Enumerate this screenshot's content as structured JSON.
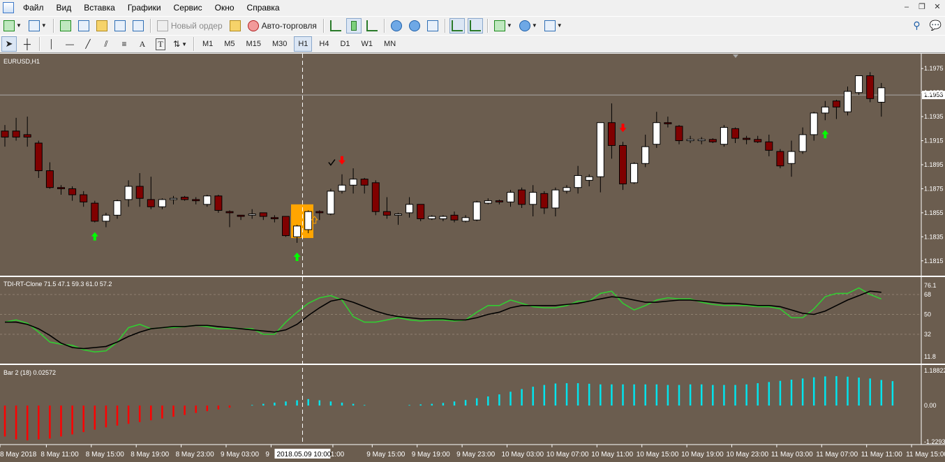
{
  "menu": [
    "Файл",
    "Вид",
    "Вставка",
    "Графики",
    "Сервис",
    "Окно",
    "Справка"
  ],
  "toolbar": {
    "new_order": "Новый ордер",
    "auto_trading": "Авто-торговля"
  },
  "timeframes": [
    "M1",
    "M5",
    "M15",
    "M30",
    "H1",
    "H4",
    "D1",
    "W1",
    "MN"
  ],
  "active_timeframe": "H1",
  "charts": {
    "main": {
      "label": "EURUSD,H1",
      "price_labels": [
        "1.1975",
        "1.1955",
        "1.1935",
        "1.1915",
        "1.1895",
        "1.1875",
        "1.1855",
        "1.1835",
        "1.1815"
      ],
      "current_price": "1.1953"
    },
    "tdi": {
      "label": "TDI-RT-Clone 71.5 47.1 59.3 61.0 57.2",
      "levels": [
        "76.1",
        "68",
        "50",
        "32",
        "11.8"
      ]
    },
    "bar2": {
      "label": "Bar 2  (18) 0.02572",
      "levels": [
        "1.18822",
        "0.00",
        "-1.22932"
      ]
    }
  },
  "time_axis": {
    "labels": [
      "8 May 2018",
      "8 May 11:00",
      "8 May 15:00",
      "8 May 19:00",
      "8 May 23:00",
      "9 May 03:00",
      "9",
      "11:00",
      "9 May 15:00",
      "9 May 19:00",
      "9 May 23:00",
      "10 May 03:00",
      "10 May 07:00",
      "10 May 11:00",
      "10 May 15:00",
      "10 May 19:00",
      "10 May 23:00",
      "11 May 03:00",
      "11 May 07:00",
      "11 May 11:00",
      "11 May 15:00"
    ],
    "crosshair_label": "2018.05.09 10:00"
  },
  "colors": {
    "chart_bg": "#6b5d4f",
    "bull_candle": "#ffffff",
    "bear_candle": "#800000",
    "tdi_green": "#32cd32",
    "tdi_black": "#000000",
    "bar_negative": "#ff0000",
    "bar_positive": "#00e5ee",
    "signal_up": "#00ff00",
    "signal_down": "#ff0000",
    "highlight": "#ffa500"
  },
  "chart_data": [
    {
      "type": "candlestick",
      "title": "EURUSD,H1",
      "ylim": [
        1.1805,
        1.1985
      ],
      "candles": [
        [
          1.1923,
          1.1928,
          1.191,
          1.1918
        ],
        [
          1.1923,
          1.1934,
          1.1915,
          1.1918
        ],
        [
          1.192,
          1.1935,
          1.191,
          1.1918
        ],
        [
          1.1913,
          1.1915,
          1.1884,
          1.189
        ],
        [
          1.189,
          1.1897,
          1.1875,
          1.1876
        ],
        [
          1.1876,
          1.1878,
          1.187,
          1.1875
        ],
        [
          1.1875,
          1.1877,
          1.1865,
          1.187
        ],
        [
          1.187,
          1.1873,
          1.186,
          1.1864
        ],
        [
          1.1863,
          1.1865,
          1.1847,
          1.1848
        ],
        [
          1.1848,
          1.1855,
          1.1843,
          1.1853
        ],
        [
          1.1853,
          1.1866,
          1.185,
          1.1865
        ],
        [
          1.1866,
          1.1882,
          1.186,
          1.1877
        ],
        [
          1.1877,
          1.1888,
          1.186,
          1.1867
        ],
        [
          1.1866,
          1.1885,
          1.1858,
          1.186
        ],
        [
          1.186,
          1.1867,
          1.1858,
          1.1866
        ],
        [
          1.1866,
          1.1869,
          1.1862,
          1.1867
        ],
        [
          1.1868,
          1.1869,
          1.1865,
          1.1866
        ],
        [
          1.1866,
          1.1868,
          1.1862,
          1.1865
        ],
        [
          1.1862,
          1.187,
          1.186,
          1.1869
        ],
        [
          1.1869,
          1.187,
          1.1855,
          1.1857
        ],
        [
          1.1856,
          1.1857,
          1.1843,
          1.1855
        ],
        [
          1.1853,
          1.1853,
          1.1849,
          1.1852
        ],
        [
          1.1853,
          1.1858,
          1.185,
          1.1854
        ],
        [
          1.1855,
          1.1855,
          1.1849,
          1.1852
        ],
        [
          1.1851,
          1.1853,
          1.1847,
          1.185
        ],
        [
          1.1852,
          1.1852,
          1.1835,
          1.1836
        ],
        [
          1.1835,
          1.1845,
          1.183,
          1.1844
        ],
        [
          1.1841,
          1.1857,
          1.1838,
          1.1856
        ],
        [
          1.1856,
          1.1857,
          1.1849,
          1.1855
        ],
        [
          1.1854,
          1.1875,
          1.1853,
          1.1873
        ],
        [
          1.1873,
          1.1887,
          1.1871,
          1.1878
        ],
        [
          1.1878,
          1.1892,
          1.1871,
          1.1883
        ],
        [
          1.1883,
          1.1884,
          1.1871,
          1.1878
        ],
        [
          1.188,
          1.1882,
          1.1853,
          1.1856
        ],
        [
          1.1856,
          1.1868,
          1.185,
          1.1853
        ],
        [
          1.1853,
          1.1855,
          1.1845,
          1.1854
        ],
        [
          1.1855,
          1.1868,
          1.1851,
          1.1862
        ],
        [
          1.1862,
          1.1862,
          1.1848,
          1.185
        ],
        [
          1.185,
          1.1853,
          1.1849,
          1.1852
        ],
        [
          1.185,
          1.1853,
          1.1848,
          1.1852
        ],
        [
          1.1853,
          1.1856,
          1.1847,
          1.1849
        ],
        [
          1.1848,
          1.1853,
          1.1847,
          1.1851
        ],
        [
          1.1849,
          1.1865,
          1.1848,
          1.1864
        ],
        [
          1.1863,
          1.1867,
          1.1862,
          1.1865
        ],
        [
          1.1865,
          1.1866,
          1.1862,
          1.1864
        ],
        [
          1.1864,
          1.1874,
          1.186,
          1.1872
        ],
        [
          1.1874,
          1.1876,
          1.1859,
          1.1862
        ],
        [
          1.1862,
          1.1878,
          1.1852,
          1.1872
        ],
        [
          1.1871,
          1.1873,
          1.1854,
          1.1859
        ],
        [
          1.1859,
          1.1876,
          1.1852,
          1.1874
        ],
        [
          1.1873,
          1.1878,
          1.1871,
          1.1876
        ],
        [
          1.1876,
          1.1894,
          1.1871,
          1.1886
        ],
        [
          1.1882,
          1.1887,
          1.1877,
          1.1885
        ],
        [
          1.1885,
          1.193,
          1.1872,
          1.193
        ],
        [
          1.193,
          1.1946,
          1.19,
          1.1911
        ],
        [
          1.1911,
          1.1914,
          1.1874,
          1.1879
        ],
        [
          1.188,
          1.1897,
          1.1879,
          1.1896
        ],
        [
          1.1896,
          1.192,
          1.1893,
          1.191
        ],
        [
          1.1912,
          1.1939,
          1.1909,
          1.193
        ],
        [
          1.193,
          1.1935,
          1.1926,
          1.1929
        ],
        [
          1.1927,
          1.1928,
          1.1912,
          1.1915
        ],
        [
          1.1915,
          1.1919,
          1.1913,
          1.1916
        ],
        [
          1.1915,
          1.1918,
          1.1912,
          1.1916
        ],
        [
          1.1916,
          1.1917,
          1.1913,
          1.1914
        ],
        [
          1.1912,
          1.1928,
          1.191,
          1.1926
        ],
        [
          1.1925,
          1.1926,
          1.1913,
          1.1917
        ],
        [
          1.1917,
          1.1919,
          1.1912,
          1.1916
        ],
        [
          1.1916,
          1.1919,
          1.1913,
          1.1914
        ],
        [
          1.1914,
          1.192,
          1.1902,
          1.1907
        ],
        [
          1.1906,
          1.1908,
          1.1892,
          1.1894
        ],
        [
          1.1896,
          1.1915,
          1.1885,
          1.1906
        ],
        [
          1.1906,
          1.1926,
          1.1904,
          1.192
        ],
        [
          1.192,
          1.1939,
          1.1915,
          1.1938
        ],
        [
          1.1938,
          1.1948,
          1.1932,
          1.1943
        ],
        [
          1.1948,
          1.1949,
          1.1933,
          1.1943
        ],
        [
          1.1939,
          1.196,
          1.1936,
          1.1956
        ],
        [
          1.1955,
          1.1969,
          1.1953,
          1.1969
        ],
        [
          1.1969,
          1.1972,
          1.1947,
          1.195
        ],
        [
          1.1947,
          1.1963,
          1.1935,
          1.1959
        ]
      ],
      "signals_up": [
        8,
        26,
        73
      ],
      "signals_down": [
        30,
        55
      ]
    },
    {
      "type": "line",
      "title": "TDI-RT-Clone 71.5 47.1 59.3 61.0 57.2",
      "ylim": [
        8,
        80
      ],
      "series": [
        {
          "values": [
            43,
            45,
            42,
            34,
            25,
            23,
            22,
            18,
            16,
            17,
            25,
            38,
            41,
            37,
            38,
            38,
            39,
            40,
            39,
            37,
            37,
            37,
            37,
            32,
            32,
            43,
            52,
            60,
            65,
            67,
            63,
            48,
            43,
            43,
            45,
            47,
            45,
            44,
            45,
            45,
            44,
            45,
            52,
            58,
            58,
            63,
            60,
            57,
            56,
            56,
            58,
            62,
            62,
            69,
            71,
            60,
            54,
            58,
            63,
            65,
            64,
            64,
            61,
            59,
            58,
            58,
            58,
            57,
            57,
            55,
            47,
            47,
            55,
            66,
            69,
            69,
            74,
            68,
            64
          ]
        },
        {
          "values": [
            43,
            43,
            41,
            37,
            31,
            24,
            20,
            19,
            20,
            21,
            25,
            30,
            34,
            37,
            38,
            39,
            39,
            40,
            40,
            39,
            38,
            37,
            36,
            35,
            34,
            36,
            41,
            49,
            56,
            62,
            64,
            61,
            57,
            53,
            50,
            48,
            47,
            46,
            46,
            46,
            45,
            45,
            47,
            50,
            52,
            56,
            58,
            58,
            58,
            58,
            59,
            60,
            62,
            64,
            66,
            65,
            63,
            61,
            61,
            62,
            63,
            63,
            62,
            61,
            60,
            60,
            59,
            58,
            58,
            57,
            54,
            51,
            50,
            53,
            58,
            63,
            67,
            71,
            70
          ]
        }
      ]
    },
    {
      "type": "bar",
      "title": "Bar 2  (18) 0.02572",
      "ylim": [
        -1.22932,
        1.18822
      ],
      "values": [
        -1.05,
        -1.15,
        -1.18,
        -1.15,
        -1.12,
        -1.05,
        -0.98,
        -0.9,
        -0.82,
        -0.74,
        -0.68,
        -0.62,
        -0.56,
        -0.5,
        -0.44,
        -0.38,
        -0.32,
        -0.25,
        -0.19,
        -0.13,
        -0.07,
        0.0,
        0.02,
        0.06,
        0.1,
        0.14,
        0.18,
        0.22,
        0.18,
        0.14,
        0.1,
        0.06,
        0.02,
        0.0,
        0.0,
        0.0,
        0.02,
        0.04,
        0.06,
        0.09,
        0.14,
        0.19,
        0.25,
        0.31,
        0.38,
        0.47,
        0.56,
        0.64,
        0.7,
        0.75,
        0.76,
        0.76,
        0.74,
        0.72,
        0.72,
        0.72,
        0.72,
        0.72,
        0.72,
        0.7,
        0.7,
        0.72,
        0.72,
        0.7,
        0.7,
        0.7,
        0.72,
        0.76,
        0.8,
        0.84,
        0.88,
        0.92,
        0.96,
        0.99,
        1.0,
        0.98,
        0.95,
        0.92,
        0.87,
        0.83
      ]
    }
  ]
}
